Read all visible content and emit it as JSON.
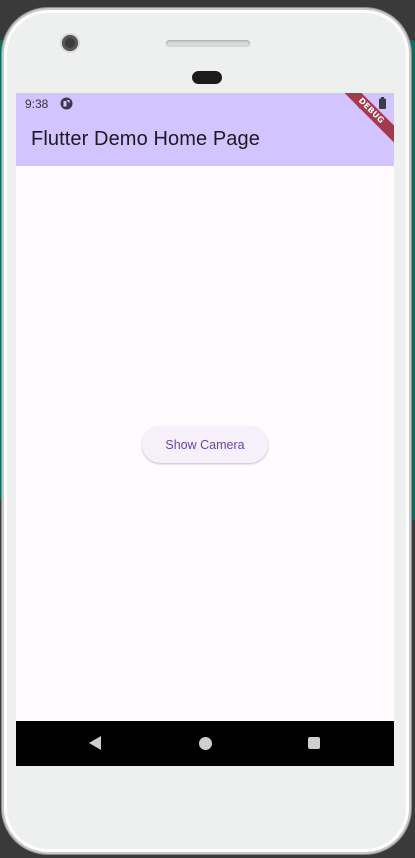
{
  "status_bar": {
    "time": "9:38",
    "app_icon": "flutter-status-icon",
    "wifi_icon": "wifi-icon",
    "battery_icon": "battery-icon"
  },
  "app_bar": {
    "title": "Flutter Demo Home Page",
    "background_color": "#d1c4ff"
  },
  "debug_banner": {
    "label": "DEBUG",
    "color": "#a33a4e"
  },
  "main": {
    "button_label": "Show Camera",
    "button_text_color": "#6646a8"
  },
  "nav_bar": {
    "back_icon": "back-triangle-icon",
    "home_icon": "home-circle-icon",
    "recents_icon": "recents-square-icon"
  }
}
